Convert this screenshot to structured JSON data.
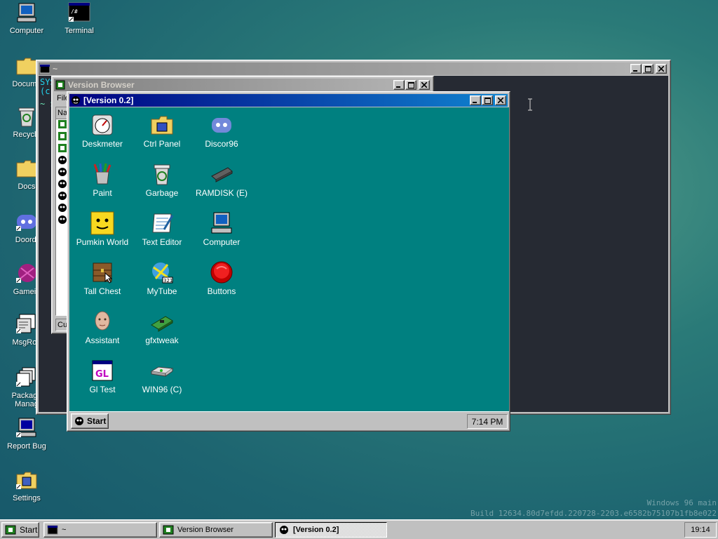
{
  "desktop": {
    "icons": [
      {
        "label": "Computer"
      },
      {
        "label": "Terminal"
      },
      {
        "label": "Docume"
      },
      {
        "label": "Recycle"
      },
      {
        "label": "Docs"
      },
      {
        "label": "Doordi"
      },
      {
        "label": "Gamein"
      },
      {
        "label": "MsgRoo"
      },
      {
        "label": "Package Manag"
      },
      {
        "label": "Report Bug"
      },
      {
        "label": "Settings"
      }
    ],
    "build_line1": "Windows 96 main",
    "build_line2": "Build 12634.80d7efdd.220728-2203.e6582b75107b1fb8e022"
  },
  "terminal_window": {
    "title": "~",
    "text_line1": "SYS",
    "text_line2": "(c",
    "text_line3": "~ $"
  },
  "version_browser": {
    "title": "Version Browser",
    "menu_file": "File",
    "column_name": "Na",
    "status": "Cur"
  },
  "version_window": {
    "title": "[Version 0.2]",
    "icons": [
      {
        "label": "Deskmeter"
      },
      {
        "label": "Ctrl Panel"
      },
      {
        "label": "Discor96"
      },
      {
        "label": "Paint"
      },
      {
        "label": "Garbage"
      },
      {
        "label": "RAMDISK (E)"
      },
      {
        "label": "Pumkin World"
      },
      {
        "label": "Text Editor"
      },
      {
        "label": "Computer"
      },
      {
        "label": "Tall Chest"
      },
      {
        "label": "MyTube"
      },
      {
        "label": "Buttons"
      },
      {
        "label": "Assistant"
      },
      {
        "label": "gfxtweak"
      },
      {
        "label": "Gl Test"
      },
      {
        "label": "WIN96 (C)"
      }
    ],
    "start_label": "Start",
    "clock": "7:14 PM"
  },
  "taskbar": {
    "start_label": "Start",
    "tasks": [
      {
        "label": "~"
      },
      {
        "label": "Version Browser"
      },
      {
        "label": "[Version 0.2]"
      }
    ],
    "clock": "19:14"
  }
}
